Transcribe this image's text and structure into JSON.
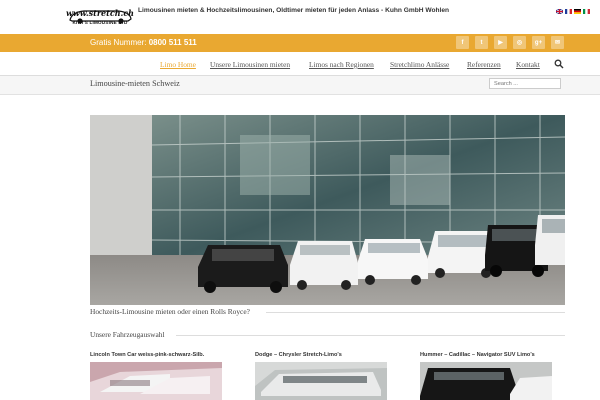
{
  "header": {
    "logo_url_text": "www.stretch.ch",
    "logo_sub_text": "KIWI'S LIMOUSINE LTD",
    "tagline": "Limousinen mieten & Hochzeitslimousinen, Oldtimer mieten für jeden Anlass - Kuhn GmbH Wohlen",
    "languages": [
      "english-flag",
      "french-flag",
      "german-flag",
      "italian-flag"
    ]
  },
  "contact_bar": {
    "phone_label": "Gratis Nummer:",
    "phone_number": "0800 511 511",
    "socials": [
      {
        "icon": "facebook-icon",
        "glyph": "f"
      },
      {
        "icon": "twitter-icon",
        "glyph": "t"
      },
      {
        "icon": "youtube-icon",
        "glyph": "▶"
      },
      {
        "icon": "instagram-icon",
        "glyph": "◎"
      },
      {
        "icon": "google-plus-icon",
        "glyph": "g+"
      },
      {
        "icon": "email-icon",
        "glyph": "✉"
      }
    ],
    "accent_color": "#e9a831"
  },
  "nav": {
    "items": [
      {
        "label": "Limo Home",
        "active": true
      },
      {
        "label": "Unsere Limousinen mieten",
        "active": false
      },
      {
        "label": "Limos nach Regionen",
        "active": false
      },
      {
        "label": "Stretchlimo Anlässe",
        "active": false
      },
      {
        "label": "Referenzen",
        "active": false
      },
      {
        "label": "Kontakt",
        "active": false
      }
    ]
  },
  "title_bar": {
    "title": "Limousine-mieten Schweiz",
    "search_placeholder": "Search ..."
  },
  "hero": {
    "caption": "Hochzeits-Limousine mieten oder einen Rolls Royce?"
  },
  "fleet": {
    "heading": "Unsere Fahrzeugauswahl",
    "vehicles": [
      {
        "title": "Lincoln Town Car weiss-pink-schwarz-Silb."
      },
      {
        "title": "Dodge – Chrysler Stretch-Limo's"
      },
      {
        "title": "Hummer – Cadillac – Navigator SUV Limo's"
      }
    ]
  }
}
